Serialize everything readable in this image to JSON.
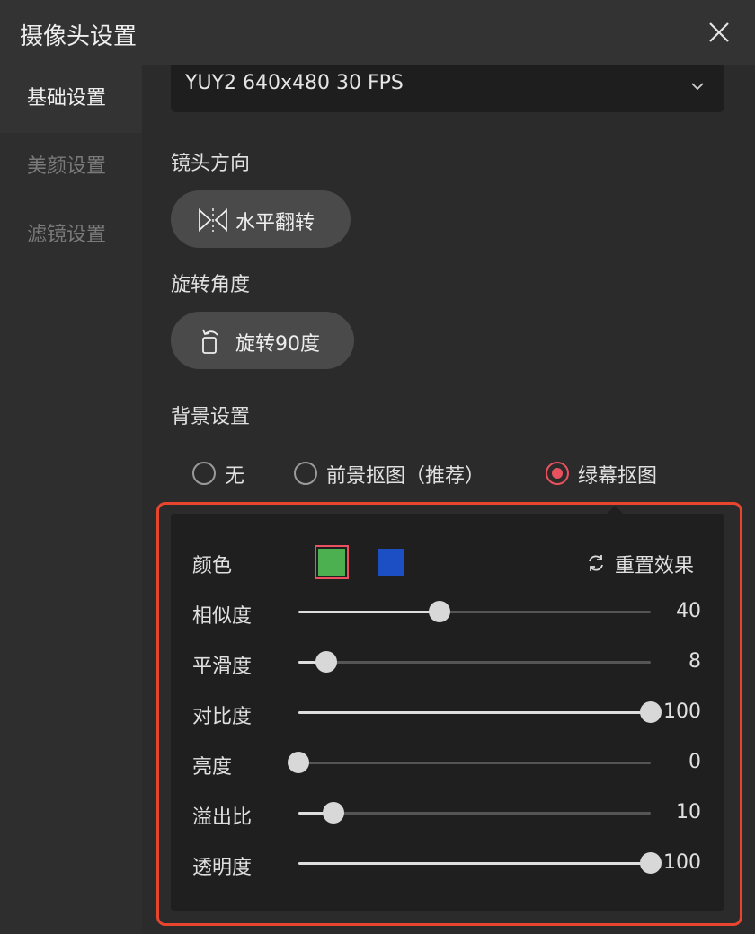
{
  "window": {
    "title": "摄像头设置"
  },
  "sidebar": {
    "items": [
      {
        "label": "基础设置",
        "active": true
      },
      {
        "label": "美颜设置",
        "active": false
      },
      {
        "label": "滤镜设置",
        "active": false
      }
    ]
  },
  "format": {
    "selected": "YUY2 640x480 30 FPS"
  },
  "lens": {
    "label": "镜头方向",
    "button": "水平翻转"
  },
  "rotation": {
    "label": "旋转角度",
    "button": "旋转90度"
  },
  "background": {
    "label": "背景设置",
    "options": [
      {
        "label": "无",
        "checked": false
      },
      {
        "label": "前景抠图（推荐）",
        "checked": false
      },
      {
        "label": "绿幕抠图",
        "checked": true
      }
    ]
  },
  "greenscreen": {
    "color_label": "颜色",
    "colors": [
      "#4caf50",
      "#1d4fc4"
    ],
    "selected_color": "#4caf50",
    "reset_label": "重置效果",
    "sliders": [
      {
        "label": "相似度",
        "value": "40",
        "fraction": 0.4
      },
      {
        "label": "平滑度",
        "value": "8",
        "fraction": 0.08
      },
      {
        "label": "对比度",
        "value": "100",
        "fraction": 1.0
      },
      {
        "label": "亮度",
        "value": "0",
        "fraction": 0.0
      },
      {
        "label": "溢出比",
        "value": "10",
        "fraction": 0.1
      },
      {
        "label": "透明度",
        "value": "100",
        "fraction": 1.0
      }
    ]
  },
  "colors": {
    "accent": "#e8515d",
    "highlight_border": "#e8452e"
  }
}
